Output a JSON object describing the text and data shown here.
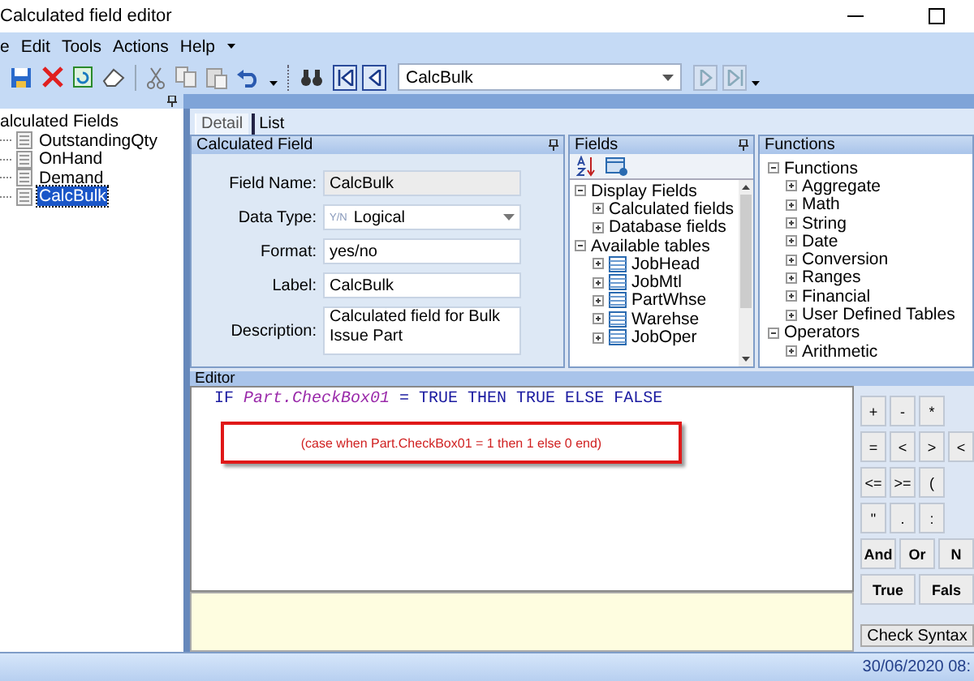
{
  "window": {
    "title": "Calculated field editor"
  },
  "menu": [
    "e",
    "Edit",
    "Tools",
    "Actions",
    "Help"
  ],
  "toolbar": {
    "record": "CalcBulk",
    "navigation": [
      {
        "kind": "first",
        "disabled": false
      },
      {
        "kind": "prev",
        "disabled": false
      }
    ],
    "navigation_end": [
      {
        "kind": "next",
        "disabled": true
      },
      {
        "kind": "last",
        "disabled": true
      }
    ]
  },
  "tree": {
    "root": "alculated Fields",
    "children": [
      {
        "label": "OutstandingQty",
        "selected": false
      },
      {
        "label": "OnHand",
        "selected": false
      },
      {
        "label": "Demand",
        "selected": false
      },
      {
        "label": "CalcBulk",
        "selected": true
      }
    ]
  },
  "tabs": [
    {
      "label": "Detail",
      "selected": true
    },
    {
      "label": "List",
      "selected": false
    }
  ],
  "calculated_field": {
    "title": "Calculated Field",
    "rows": [
      {
        "label": "Field Name:",
        "kind": "readonly",
        "value": "CalcBulk"
      },
      {
        "label": "Data Type:",
        "kind": "dropdown",
        "badge": "Y/N",
        "value": "Logical"
      },
      {
        "label": "Format:",
        "kind": "text",
        "value": "yes/no"
      },
      {
        "label": "Label:",
        "kind": "text",
        "value": "CalcBulk"
      },
      {
        "label": "Description:",
        "kind": "textarea",
        "value": "Calculated field for Bulk Issue Part"
      }
    ]
  },
  "fields": {
    "title": "Fields",
    "tree": [
      {
        "label": "Display Fields",
        "expanded": true,
        "children": [
          {
            "label": "Calculated fields",
            "expanded": false,
            "kind": "group"
          },
          {
            "label": "Database fields",
            "expanded": false,
            "kind": "group"
          }
        ]
      },
      {
        "label": "Available tables",
        "expanded": true,
        "children": [
          {
            "label": "JobHead",
            "expanded": false,
            "kind": "table"
          },
          {
            "label": "JobMtl",
            "expanded": false,
            "kind": "table"
          },
          {
            "label": "PartWhse",
            "expanded": false,
            "kind": "table"
          },
          {
            "label": "Warehse",
            "expanded": false,
            "kind": "table"
          },
          {
            "label": "JobOper",
            "expanded": false,
            "kind": "table"
          }
        ]
      }
    ]
  },
  "functions": {
    "title": "Functions",
    "tree": [
      {
        "label": "Functions",
        "expanded": true,
        "children": [
          {
            "label": "Aggregate",
            "expanded": false
          },
          {
            "label": "Math",
            "expanded": false
          },
          {
            "label": "String",
            "expanded": false
          },
          {
            "label": "Date",
            "expanded": false
          },
          {
            "label": "Conversion",
            "expanded": false
          },
          {
            "label": "Ranges",
            "expanded": false
          },
          {
            "label": "Financial",
            "expanded": false
          },
          {
            "label": "User Defined Tables",
            "expanded": false
          }
        ]
      },
      {
        "label": "Operators",
        "expanded": true,
        "children": [
          {
            "label": "Arithmetic",
            "expanded": false
          }
        ]
      }
    ]
  },
  "editor": {
    "title": "Editor",
    "code": [
      {
        "text": "IF",
        "kind": "keyword"
      },
      {
        "text": "Part.CheckBox01",
        "kind": "field"
      },
      {
        "text": "=",
        "kind": "operator"
      },
      {
        "text": "TRUE THEN TRUE ELSE FALSE",
        "kind": "keyword"
      }
    ],
    "annotation": "(case when Part.CheckBox01 = 1 then 1 else 0 end)"
  },
  "keypad": [
    [
      "+",
      "-",
      "*"
    ],
    [
      "=",
      "<",
      ">",
      "<"
    ],
    [
      "<=",
      ">=",
      "("
    ],
    [
      "\"",
      ".",
      ":"
    ],
    [
      "And",
      "Or",
      "N"
    ],
    [
      "True",
      "Fals"
    ]
  ],
  "check_syntax": "Check Syntax",
  "status_bar": {
    "datetime": "30/06/2020 08:"
  }
}
